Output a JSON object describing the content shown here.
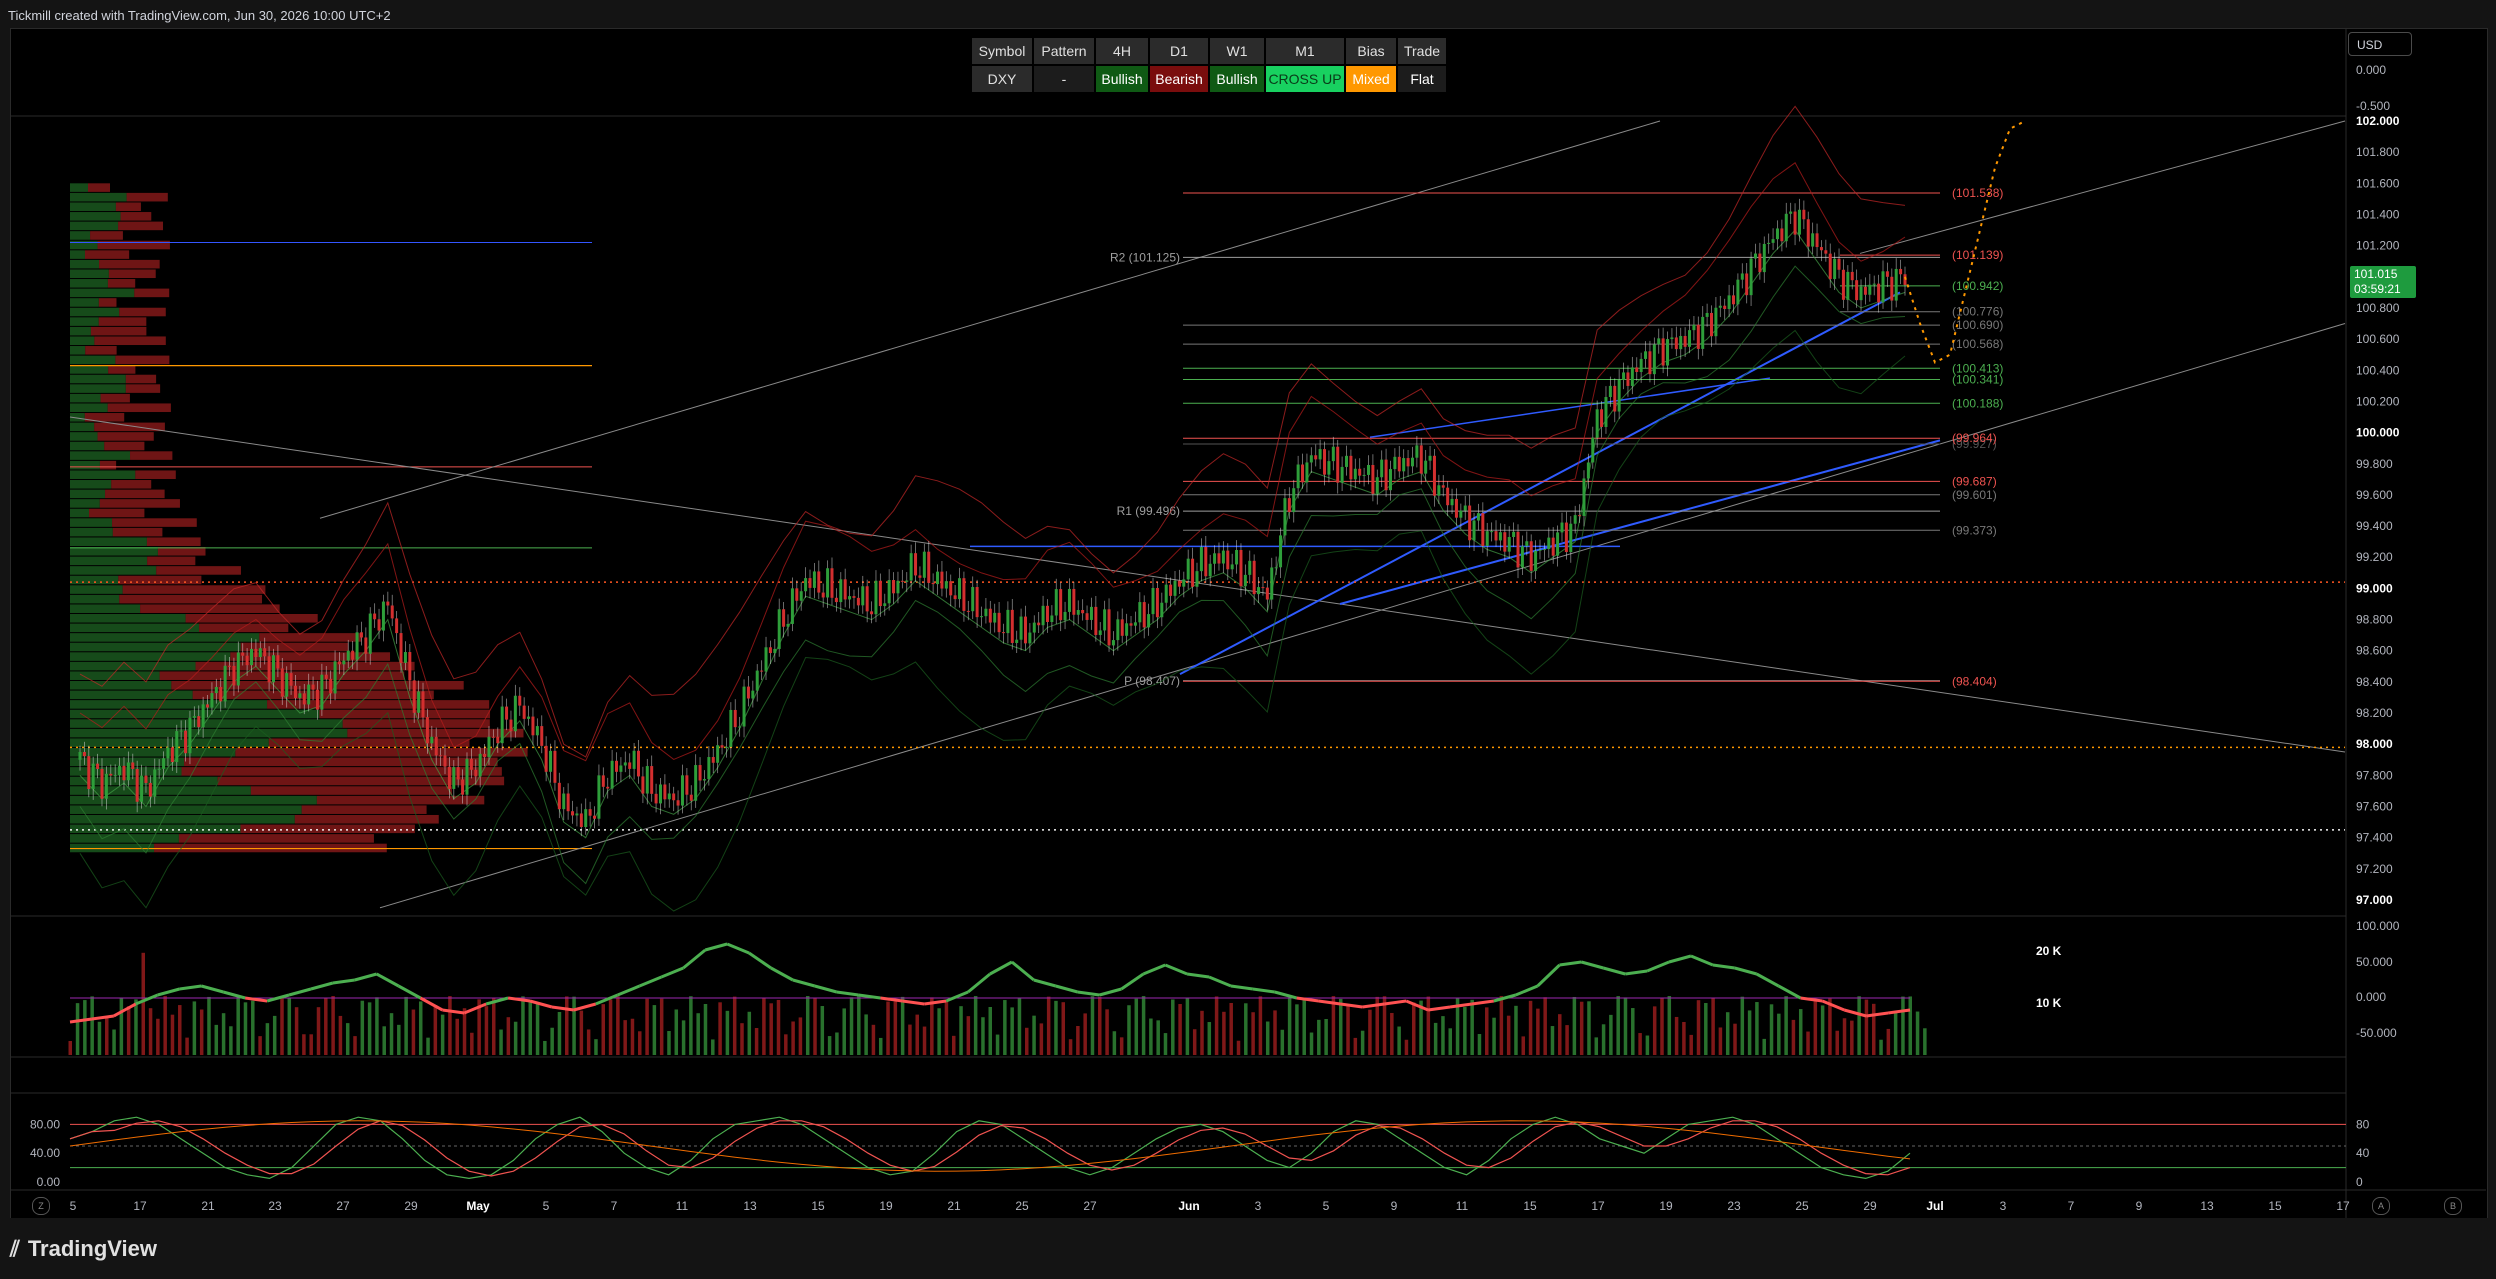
{
  "header": {
    "caption": "Tickmill created with TradingView.com, Jun 30, 2026 10:00 UTC+2"
  },
  "currency_selector": {
    "value": "USD"
  },
  "status_table": {
    "headers": [
      "Symbol",
      "Pattern",
      "4H",
      "D1",
      "W1",
      "M1",
      "Bias",
      "Trade"
    ],
    "row": [
      {
        "text": "DXY",
        "bg": "#2b2b2b",
        "fg": "#e0e0e0"
      },
      {
        "text": "-",
        "bg": "#1c1c1c",
        "fg": "#e0e0e0"
      },
      {
        "text": "Bullish",
        "bg": "#0f5a14",
        "fg": "#ffffff"
      },
      {
        "text": "Bearish",
        "bg": "#7a0d0d",
        "fg": "#ffffff"
      },
      {
        "text": "Bullish",
        "bg": "#0f5a14",
        "fg": "#ffffff"
      },
      {
        "text": "CROSS UP",
        "bg": "#18d160",
        "fg": "#0a3a18"
      },
      {
        "text": "Mixed",
        "bg": "#ff9800",
        "fg": "#ffffff"
      },
      {
        "text": "Flat",
        "bg": "#1c1c1c",
        "fg": "#ffffff"
      }
    ]
  },
  "current_price": {
    "value": "101.015",
    "countdown": "03:59:21",
    "color": "#1e9b3e"
  },
  "footer": {
    "brand": "TradingView"
  },
  "nav_buttons": {
    "left": "Z",
    "a": "A",
    "b": "B"
  },
  "chart_data": [
    {
      "type": "line",
      "name": "DXY price",
      "y_range": [
        97.0,
        102.0
      ],
      "y_ticks": [
        "102.000",
        "101.800",
        "101.600",
        "101.400",
        "101.200",
        "101.000",
        "100.800",
        "100.600",
        "100.400",
        "100.200",
        "100.000",
        "99.800",
        "99.600",
        "99.400",
        "99.200",
        "99.000",
        "98.800",
        "98.600",
        "98.400",
        "98.200",
        "98.000",
        "97.800",
        "97.600",
        "97.400",
        "97.200",
        "97.000"
      ],
      "top_extra_ticks": [
        "0.000",
        "-0.500"
      ],
      "x_labels": [
        "5",
        "17",
        "21",
        "23",
        "27",
        "29",
        "May",
        "5",
        "7",
        "11",
        "13",
        "15",
        "19",
        "21",
        "25",
        "27",
        "Jun",
        "3",
        "5",
        "9",
        "11",
        "15",
        "17",
        "19",
        "23",
        "25",
        "29",
        "Jul",
        "3",
        "7",
        "9",
        "13",
        "15",
        "17"
      ],
      "close_series": [
        97.9,
        97.75,
        97.85,
        97.7,
        97.95,
        98.1,
        98.3,
        98.5,
        98.6,
        98.45,
        98.3,
        98.35,
        98.55,
        98.7,
        98.9,
        98.4,
        98.0,
        97.75,
        97.85,
        98.1,
        98.25,
        98.0,
        97.6,
        97.5,
        97.8,
        97.9,
        97.7,
        97.65,
        97.75,
        97.95,
        98.2,
        98.5,
        98.8,
        99.05,
        99.0,
        98.95,
        98.9,
        99.0,
        99.15,
        99.05,
        98.95,
        98.85,
        98.75,
        98.7,
        98.85,
        98.9,
        98.8,
        98.7,
        98.8,
        98.9,
        99.05,
        99.15,
        99.2,
        99.1,
        98.95,
        99.6,
        99.85,
        99.8,
        99.75,
        99.7,
        99.8,
        99.85,
        99.6,
        99.45,
        99.35,
        99.3,
        99.2,
        99.3,
        99.4,
        100.1,
        100.3,
        100.45,
        100.55,
        100.6,
        100.7,
        100.85,
        101.05,
        101.25,
        101.4,
        101.2,
        101.0,
        100.9,
        100.95,
        101.0
      ],
      "series_colors": {
        "up": "#26a69a",
        "down": "#ef5350",
        "bull_candle": "#1f8a2b",
        "bear_candle": "#c9302c"
      },
      "projection": [
        101.0,
        100.7,
        100.45,
        100.5,
        100.9,
        101.3,
        101.7,
        101.95,
        102.0
      ],
      "level_labels": [
        {
          "text": "(101.538)",
          "value": 101.538,
          "color": "#ef5350"
        },
        {
          "text": "R2 (101.125)",
          "value": 101.125,
          "color": "#9e9e9e"
        },
        {
          "text": "(101.139)",
          "value": 101.139,
          "color": "#ef5350"
        },
        {
          "text": "(100.942)",
          "value": 100.942,
          "color": "#4caf50"
        },
        {
          "text": "(100.776)",
          "value": 100.776,
          "color": "#787878"
        },
        {
          "text": "(100.690)",
          "value": 100.69,
          "color": "#787878"
        },
        {
          "text": "(100.568)",
          "value": 100.568,
          "color": "#787878"
        },
        {
          "text": "(100.413)",
          "value": 100.413,
          "color": "#4caf50"
        },
        {
          "text": "(100.341)",
          "value": 100.341,
          "color": "#4caf50"
        },
        {
          "text": "(100.188)",
          "value": 100.188,
          "color": "#4caf50"
        },
        {
          "text": "(99.927)",
          "value": 99.927,
          "color": "#555555"
        },
        {
          "text": "(99.964)",
          "value": 99.964,
          "color": "#ef5350"
        },
        {
          "text": "(99.687)",
          "value": 99.687,
          "color": "#ef5350"
        },
        {
          "text": "(99.601)",
          "value": 99.601,
          "color": "#787878"
        },
        {
          "text": "R1 (99.496)",
          "value": 99.496,
          "color": "#9e9e9e"
        },
        {
          "text": "(99.373)",
          "value": 99.373,
          "color": "#787878"
        },
        {
          "text": "P (98.407)",
          "value": 98.407,
          "color": "#9e9e9e"
        },
        {
          "text": "(98.404)",
          "value": 98.404,
          "color": "#ef5350"
        }
      ],
      "dotted_levels": [
        {
          "value": 99.04,
          "color": "#ff5722"
        },
        {
          "value": 97.98,
          "color": "#ff9800"
        },
        {
          "value": 97.45,
          "color": "#f5f5f5"
        }
      ]
    },
    {
      "type": "bar",
      "name": "Volume oscillator",
      "y_ticks_left": [
        "20 K",
        "10 K"
      ],
      "y_ticks_right": [
        "100.000",
        "50.000",
        "0.000",
        "-50.000"
      ],
      "osc_values": [
        -40,
        -35,
        -30,
        -10,
        5,
        15,
        20,
        10,
        0,
        -5,
        5,
        15,
        25,
        30,
        40,
        20,
        0,
        -20,
        -25,
        -10,
        0,
        -5,
        -15,
        -20,
        -10,
        5,
        20,
        35,
        50,
        80,
        90,
        75,
        50,
        30,
        20,
        10,
        5,
        0,
        -5,
        -10,
        -5,
        10,
        40,
        60,
        30,
        20,
        10,
        5,
        15,
        40,
        55,
        40,
        35,
        20,
        15,
        10,
        0,
        -5,
        -10,
        -15,
        -10,
        -5,
        -20,
        -15,
        -10,
        -5,
        5,
        20,
        55,
        60,
        50,
        40,
        45,
        60,
        70,
        55,
        50,
        40,
        20,
        0,
        -5,
        -20,
        -30,
        -25,
        -20
      ]
    },
    {
      "type": "line",
      "name": "Stochastic",
      "y_ticks": [
        "80.00",
        "40.00",
        "0.00"
      ],
      "y_ticks_right": [
        "80",
        "40",
        "0"
      ],
      "k_values": [
        60,
        70,
        85,
        90,
        80,
        60,
        40,
        20,
        10,
        5,
        20,
        50,
        80,
        90,
        85,
        60,
        30,
        10,
        5,
        10,
        30,
        60,
        80,
        90,
        70,
        40,
        20,
        10,
        30,
        60,
        80,
        85,
        90,
        80,
        60,
        40,
        20,
        10,
        15,
        40,
        70,
        85,
        80,
        60,
        40,
        20,
        10,
        20,
        40,
        60,
        75,
        80,
        70,
        50,
        30,
        20,
        40,
        70,
        85,
        80,
        60,
        40,
        20,
        10,
        30,
        60,
        80,
        90,
        80,
        60,
        50,
        40,
        60,
        80,
        85,
        90,
        80,
        60,
        40,
        20,
        10,
        5,
        15,
        40
      ]
    }
  ]
}
